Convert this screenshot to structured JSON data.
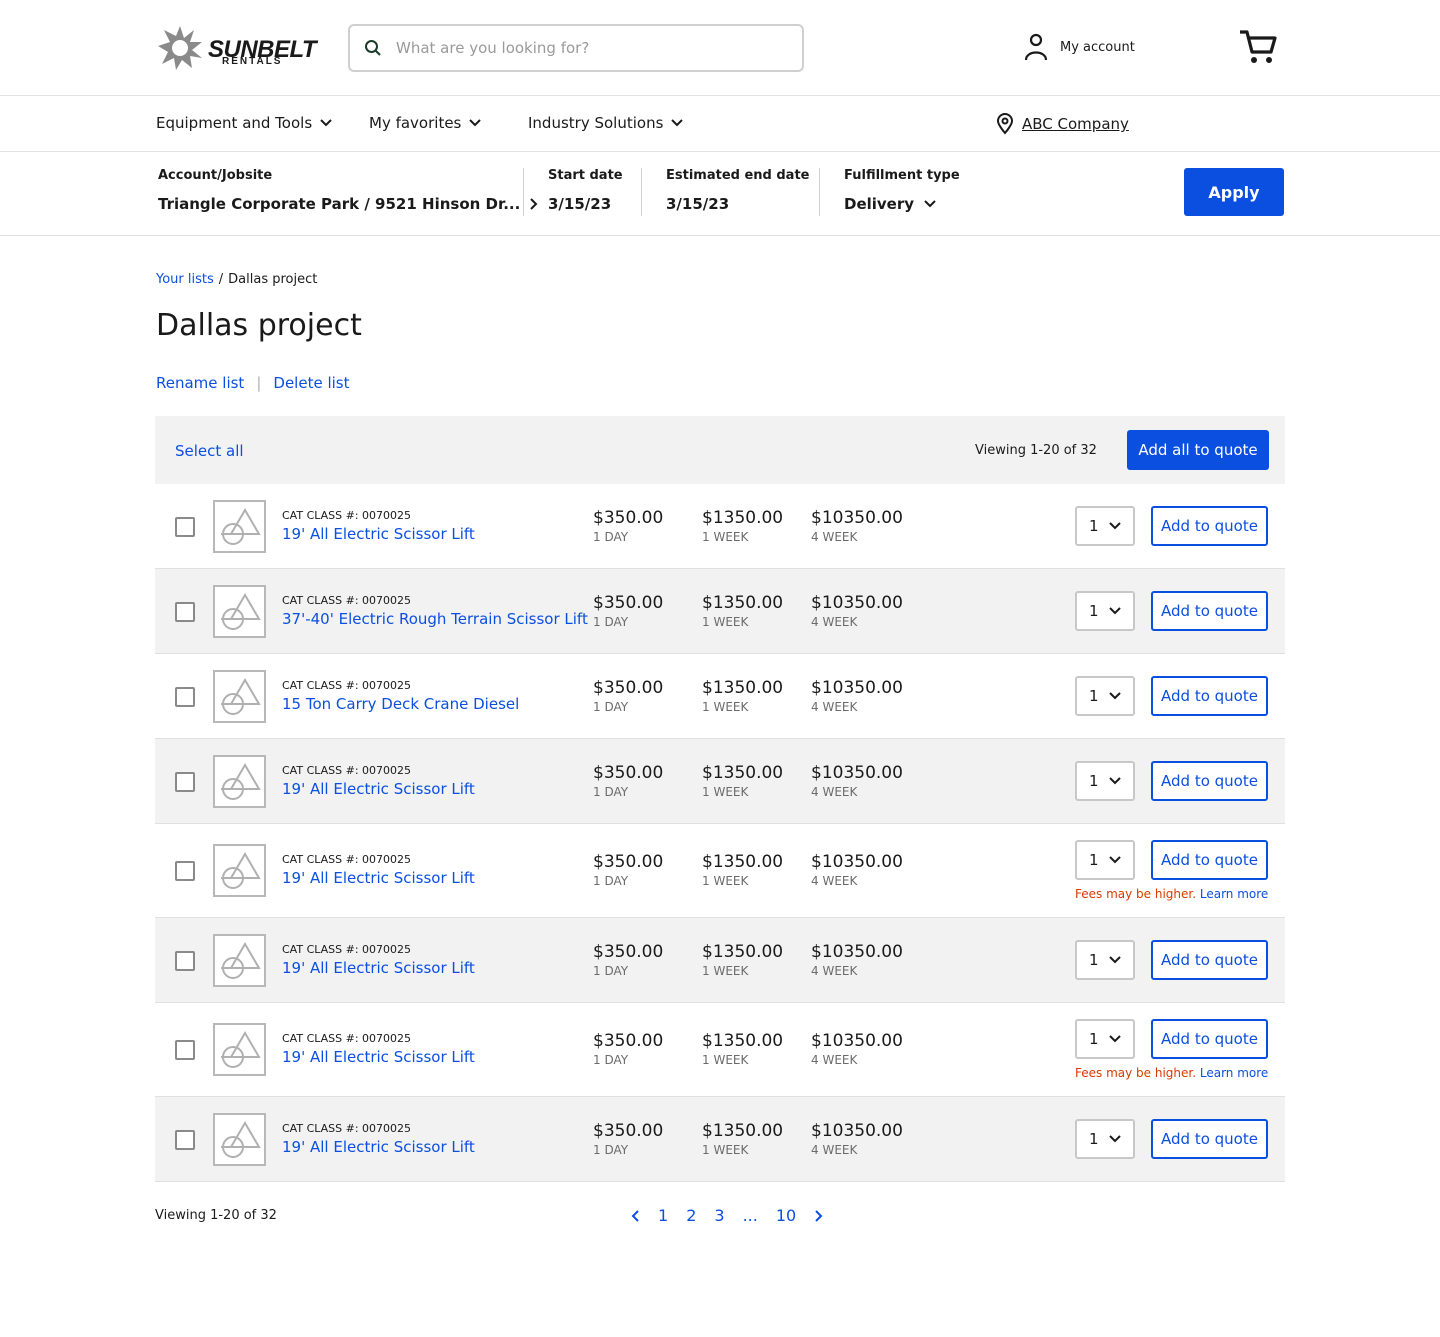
{
  "header": {
    "logo_main": "SUNBELT",
    "logo_sub": "RENTALS",
    "search_placeholder": "What are you looking for?",
    "account_label": "My account"
  },
  "nav": {
    "items": [
      "Equipment and Tools",
      "My favorites",
      "Industry Solutions"
    ],
    "company": "ABC Company"
  },
  "filters": {
    "account_label": "Account/Jobsite",
    "account_value": "Triangle Corporate Park / 9521 Hinson Dr...",
    "start_label": "Start date",
    "start_value": "3/15/23",
    "end_label": "Estimated end date",
    "end_value": "3/15/23",
    "fulfillment_label": "Fulfillment type",
    "fulfillment_value": "Delivery",
    "apply_label": "Apply"
  },
  "breadcrumb": {
    "parent": "Your lists",
    "sep": "/",
    "current": "Dallas project"
  },
  "page_title": "Dallas project",
  "list_actions": {
    "rename": "Rename list",
    "delete": "Delete list"
  },
  "toolbar": {
    "select_all": "Select all",
    "viewing": "Viewing 1-20 of 32",
    "add_all": "Add all to quote"
  },
  "rows": [
    {
      "cat": "CAT CLASS #: 0070025",
      "name": "19' All Electric Scissor Lift",
      "p1": "$350.00",
      "u1": "1 DAY",
      "p2": "$1350.00",
      "u2": "1 WEEK",
      "p3": "$10350.00",
      "u3": "4 WEEK",
      "qty": "1",
      "btn": "Add to quote"
    },
    {
      "cat": "CAT CLASS #: 0070025",
      "name": "37'-40' Electric Rough Terrain Scissor Lift",
      "p1": "$350.00",
      "u1": "1 DAY",
      "p2": "$1350.00",
      "u2": "1 WEEK",
      "p3": "$10350.00",
      "u3": "4 WEEK",
      "qty": "1",
      "btn": "Add to quote"
    },
    {
      "cat": "CAT CLASS #: 0070025",
      "name": "15 Ton Carry Deck Crane Diesel",
      "p1": "$350.00",
      "u1": "1 DAY",
      "p2": "$1350.00",
      "u2": "1 WEEK",
      "p3": "$10350.00",
      "u3": "4 WEEK",
      "qty": "1",
      "btn": "Add to quote"
    },
    {
      "cat": "CAT CLASS #: 0070025",
      "name": "19' All Electric Scissor Lift",
      "p1": "$350.00",
      "u1": "1 DAY",
      "p2": "$1350.00",
      "u2": "1 WEEK",
      "p3": "$10350.00",
      "u3": "4 WEEK",
      "qty": "1",
      "btn": "Add to quote"
    },
    {
      "cat": "CAT CLASS #: 0070025",
      "name": "19' All Electric Scissor Lift",
      "p1": "$350.00",
      "u1": "1 DAY",
      "p2": "$1350.00",
      "u2": "1 WEEK",
      "p3": "$10350.00",
      "u3": "4 WEEK",
      "qty": "1",
      "btn": "Add to quote",
      "fee_warn": "Fees may be higher.",
      "fee_link": "Learn more"
    },
    {
      "cat": "CAT CLASS #: 0070025",
      "name": "19' All Electric Scissor Lift",
      "p1": "$350.00",
      "u1": "1 DAY",
      "p2": "$1350.00",
      "u2": "1 WEEK",
      "p3": "$10350.00",
      "u3": "4 WEEK",
      "qty": "1",
      "btn": "Add to quote"
    },
    {
      "cat": "CAT CLASS #: 0070025",
      "name": "19' All Electric Scissor Lift",
      "p1": "$350.00",
      "u1": "1 DAY",
      "p2": "$1350.00",
      "u2": "1 WEEK",
      "p3": "$10350.00",
      "u3": "4 WEEK",
      "qty": "1",
      "btn": "Add to quote",
      "fee_warn": "Fees may be higher.",
      "fee_link": "Learn more"
    },
    {
      "cat": "CAT CLASS #: 0070025",
      "name": "19' All Electric Scissor Lift",
      "p1": "$350.00",
      "u1": "1 DAY",
      "p2": "$1350.00",
      "u2": "1 WEEK",
      "p3": "$10350.00",
      "u3": "4 WEEK",
      "qty": "1",
      "btn": "Add to quote"
    }
  ],
  "footer": {
    "viewing": "Viewing 1-20 of 32",
    "pages": [
      "1",
      "2",
      "3",
      "...",
      "10"
    ]
  },
  "colors": {
    "accent": "#0b4fe0",
    "warning": "#d83a00",
    "row_alt": "#f2f2f2"
  }
}
